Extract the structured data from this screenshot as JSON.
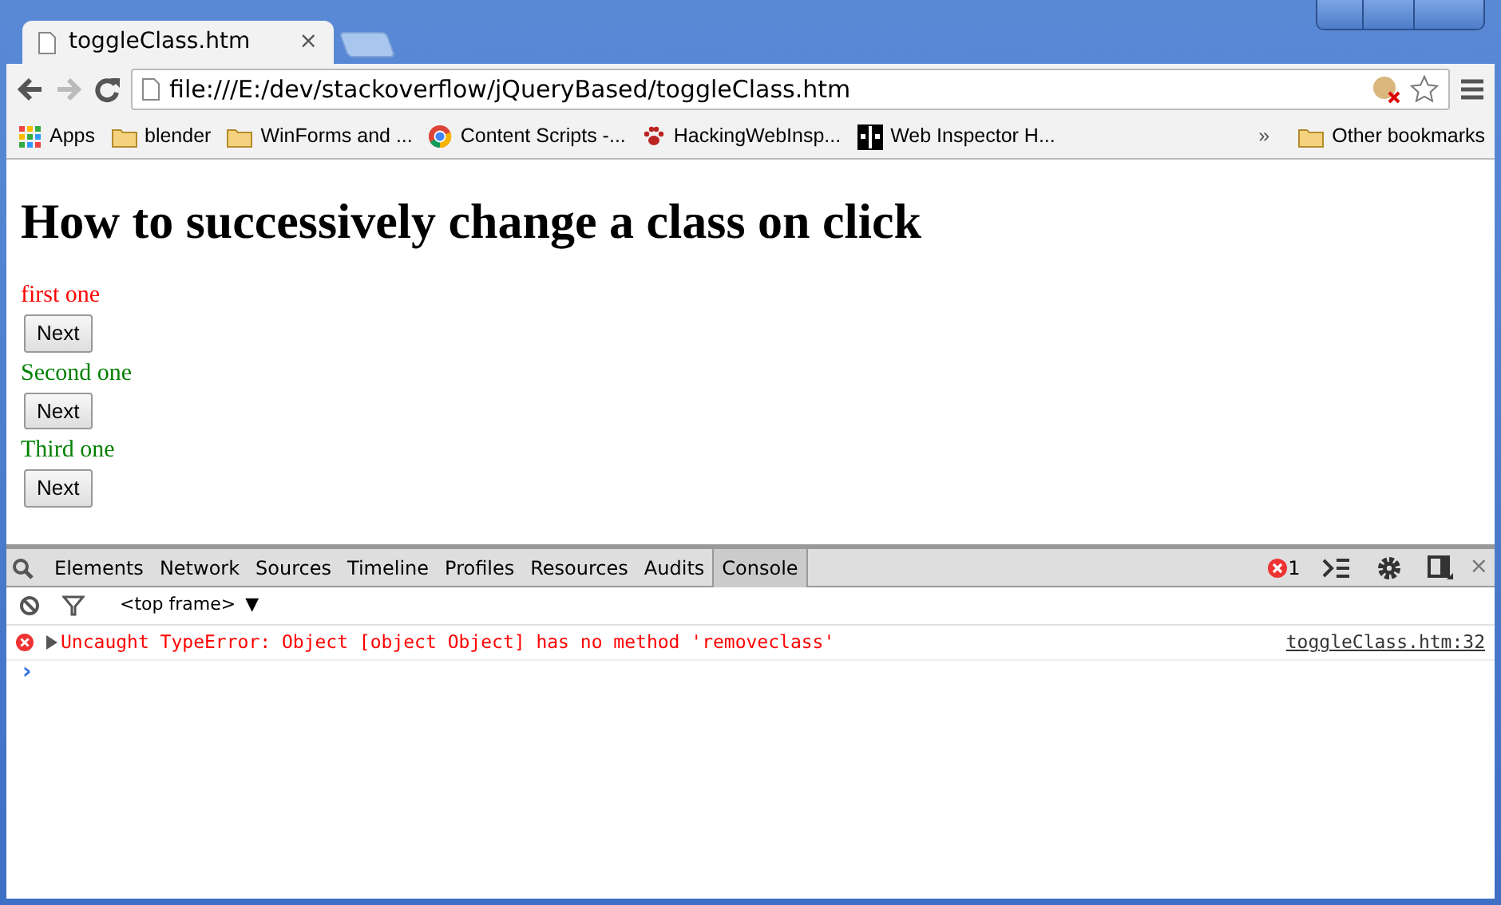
{
  "tab": {
    "title": "toggleClass.htm",
    "close": "×"
  },
  "address": "file:///E:/dev/stackoverflow/jQueryBased/toggleClass.htm",
  "bookmarks": [
    {
      "kind": "apps",
      "label": "Apps"
    },
    {
      "kind": "folder",
      "label": "blender"
    },
    {
      "kind": "folder",
      "label": "WinForms and ..."
    },
    {
      "kind": "chrome",
      "label": "Content Scripts -..."
    },
    {
      "kind": "paw",
      "label": "HackingWebInsp..."
    },
    {
      "kind": "inspector",
      "label": "Web Inspector H..."
    }
  ],
  "bookmarks_more": "»",
  "other_bookmarks": "Other bookmarks",
  "page": {
    "heading": "How to successively change a class on click",
    "items": [
      {
        "text": "first one",
        "color": "#ff0000",
        "button": "Next"
      },
      {
        "text": "Second one",
        "color": "#008000",
        "button": "Next"
      },
      {
        "text": "Third one",
        "color": "#008000",
        "button": "Next"
      }
    ]
  },
  "devtools": {
    "tabs": [
      {
        "label": "Elements",
        "selected": false
      },
      {
        "label": "Network",
        "selected": false
      },
      {
        "label": "Sources",
        "selected": false
      },
      {
        "label": "Timeline",
        "selected": false
      },
      {
        "label": "Profiles",
        "selected": false
      },
      {
        "label": "Resources",
        "selected": false
      },
      {
        "label": "Audits",
        "selected": false
      },
      {
        "label": "Console",
        "selected": true
      }
    ],
    "error_count": "1",
    "close": "×",
    "frame": "<top frame>",
    "frame_caret": "▼",
    "messages": [
      {
        "text": "Uncaught TypeError: Object [object Object] has no method 'removeclass'",
        "source": "toggleClass.htm:32"
      }
    ],
    "prompt": "›"
  }
}
